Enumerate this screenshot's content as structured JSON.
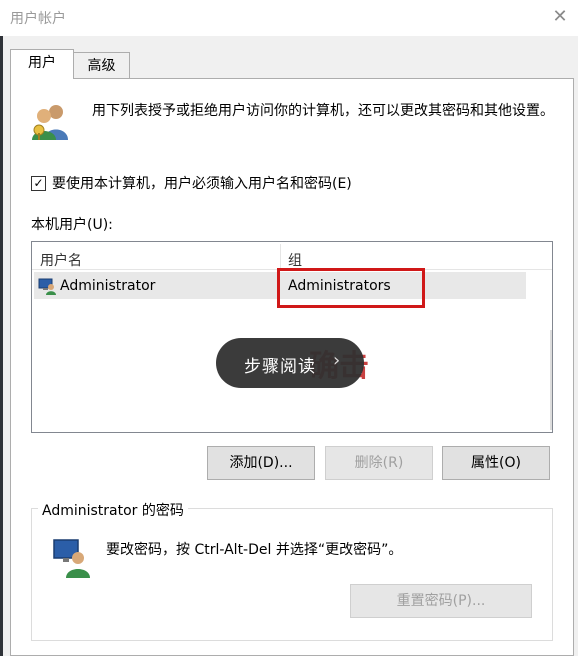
{
  "window": {
    "title": "用户帐户",
    "close_symbol": "✕"
  },
  "tabs": [
    {
      "label": "用户",
      "active": true
    },
    {
      "label": "高级",
      "active": false
    }
  ],
  "description": "用下列表授予或拒绝用户访问你的计算机，还可以更改其密码和其他设置。",
  "require_login": {
    "label": "要使用本计算机，用户必须输入用户名和密码(E)",
    "checked": true,
    "check_symbol": "✓"
  },
  "users_list": {
    "label": "本机用户(U):",
    "columns": [
      "用户名",
      "组"
    ],
    "rows": [
      {
        "username": "Administrator",
        "group": "Administrators",
        "selected": true
      }
    ]
  },
  "buttons": {
    "add": "添加(D)...",
    "remove": "删除(R)",
    "properties": "属性(O)"
  },
  "overlay": {
    "text": "步骤阅读",
    "chevron": "›",
    "red_text": "确击"
  },
  "password_group": {
    "title": "Administrator 的密码",
    "text": "要改密码，按 Ctrl-Alt-Del 并选择“更改密码”。",
    "reset_button": "重置密码(P)..."
  },
  "colors": {
    "highlight": "#d01818",
    "disabled_text": "#a0a0a0",
    "row_selected": "#e8e8e8"
  },
  "icons": [
    "users-icon",
    "administrator-icon",
    "password-user-icon",
    "close-icon",
    "checkbox-check-icon",
    "chevron-right-icon"
  ]
}
